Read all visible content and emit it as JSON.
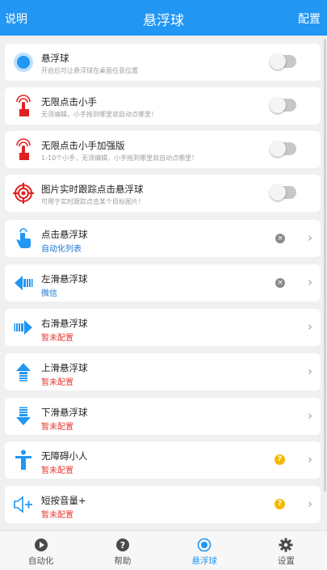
{
  "header": {
    "left_label": "说明",
    "title": "悬浮球",
    "right_label": "配置"
  },
  "toggle_rows": [
    {
      "title": "悬浮球",
      "subtitle": "开启后可让悬浮球在桌面任意位置",
      "enabled": false,
      "icon": "float-ball-icon"
    },
    {
      "title": "无限点击小手",
      "subtitle": "无须编辑，小手拖到哪里就自动点哪里！",
      "enabled": false,
      "icon": "click-hand-icon"
    },
    {
      "title": "无限点击小手加强版",
      "subtitle": "1-10个小手，无须编辑，小手拖到哪里就自动点哪里！",
      "enabled": false,
      "icon": "click-hand-plus-icon"
    },
    {
      "title": "图片实时跟踪点击悬浮球",
      "subtitle": "可用于实时跟踪点击某个目标图片！",
      "enabled": false,
      "icon": "target-icon"
    }
  ],
  "action_rows": [
    {
      "title": "点击悬浮球",
      "status": "自动化列表",
      "icon": "tap-finger-icon",
      "trailing": "clear"
    },
    {
      "title": "左滑悬浮球",
      "status": "微信",
      "icon": "swipe-left-icon",
      "trailing": "clear"
    },
    {
      "title": "右滑悬浮球",
      "status": "暂未配置",
      "icon": "swipe-right-icon",
      "trailing": "none"
    },
    {
      "title": "上滑悬浮球",
      "status": "暂未配置",
      "icon": "swipe-up-icon",
      "trailing": "none"
    },
    {
      "title": "下滑悬浮球",
      "status": "暂未配置",
      "icon": "swipe-down-icon",
      "trailing": "none"
    },
    {
      "title": "无障碍小人",
      "status": "暂未配置",
      "icon": "accessibility-icon",
      "trailing": "help"
    },
    {
      "title": "短按音量+",
      "status": "暂未配置",
      "icon": "volume-up-icon",
      "trailing": "help"
    }
  ],
  "badges": {
    "clear": "×",
    "help": "?",
    "chevron": "›"
  },
  "tabs": [
    {
      "label": "自动化",
      "icon": "play-circle-icon",
      "active": false
    },
    {
      "label": "帮助",
      "icon": "help-circle-icon",
      "active": false
    },
    {
      "label": "悬浮球",
      "icon": "float-ball-tab-icon",
      "active": true
    },
    {
      "label": "设置",
      "icon": "gear-icon",
      "active": false
    }
  ],
  "colors": {
    "primary": "#2196f3",
    "not_configured": "#e53935",
    "configured": "#1976d2",
    "red_icon": "#e02020",
    "help_badge": "#f5b800"
  }
}
